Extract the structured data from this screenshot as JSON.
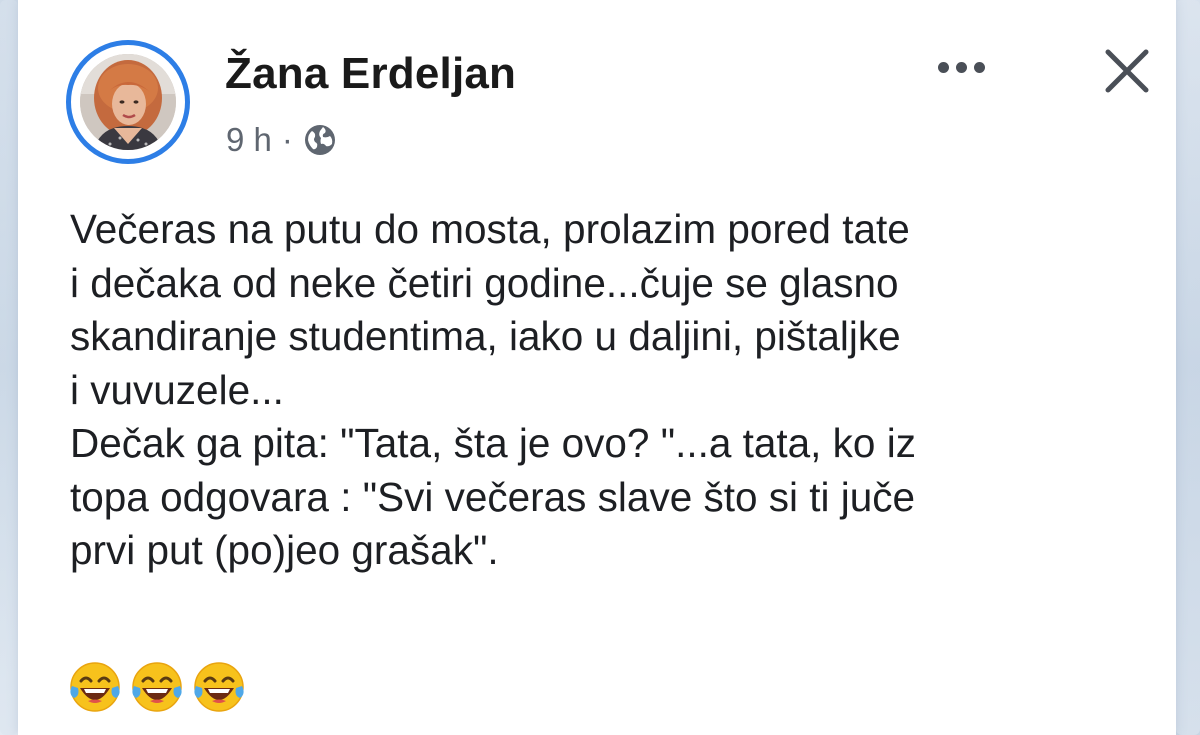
{
  "post": {
    "author": "Žana Erdeljan",
    "time": "9 h",
    "separator": "·",
    "privacy_icon": "globe-icon",
    "text": "Večeras na putu do mosta, prolazim pored tate\ni dečaka od neke četiri godine...čuje se glasno\nskandiranje studentima, iako u daljini, pištaljke\ni vuvuzele...\nDečak ga pita: \"Tata, šta je ovo? \"...a tata, ko iz\ntopa odgovara : \"Svi večeras slave što si ti juče\nprvi put (po)jeo grašak\".",
    "emoji_icon": "tears-of-joy-emoji",
    "emoji_count": 3
  },
  "header": {
    "more_icon": "more-options-icon",
    "close_icon": "close-icon"
  },
  "colors": {
    "avatar_ring": "#2d7ee6",
    "text": "#1d1f23",
    "meta": "#5f6670",
    "icon": "#4a4f57"
  }
}
